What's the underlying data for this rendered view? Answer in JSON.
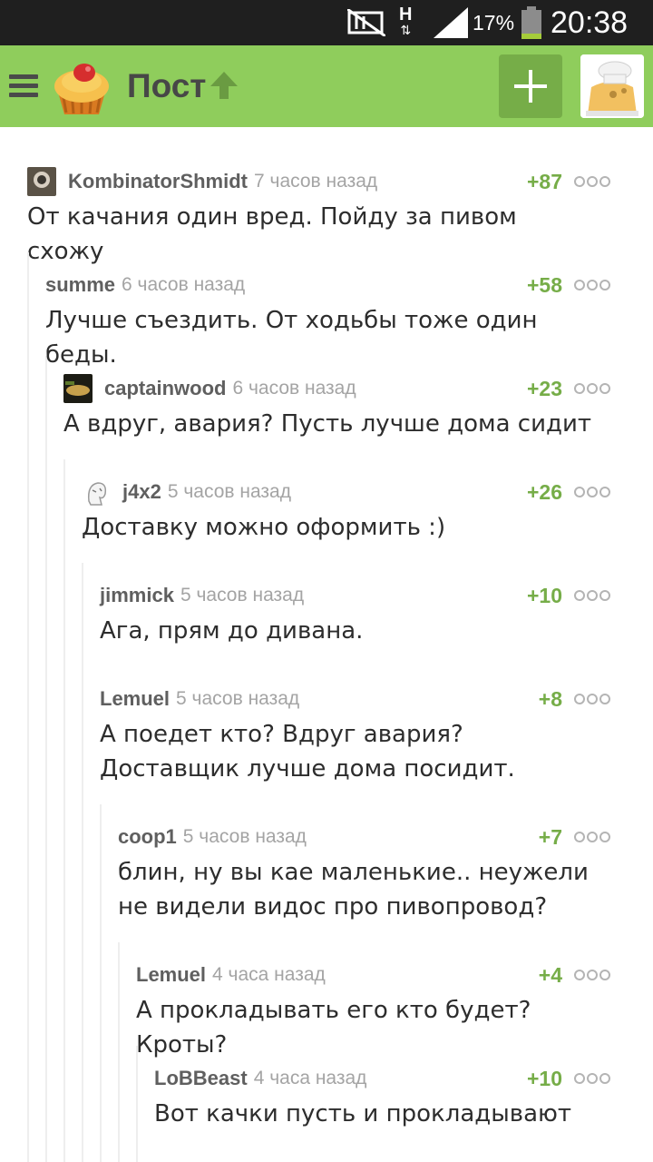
{
  "status_bar": {
    "battery": "17%",
    "time": "20:38",
    "network": "H"
  },
  "header": {
    "title": "Пост"
  },
  "comments": [
    {
      "author": "KombinatorShmidt",
      "time": "7 часов назад",
      "rating": "+87",
      "text": "От качания один вред. Пойду за пивом схожу",
      "avatar": "user-avatar"
    },
    {
      "author": "summe",
      "time": "6 часов назад",
      "rating": "+58",
      "text": "Лучше съездить. От ходьбы тоже один беды.",
      "avatar": ""
    },
    {
      "author": "captainwood",
      "time": "6 часов назад",
      "rating": "+23",
      "text": "А вдруг, авария? Пусть лучше дома сидит",
      "avatar": "user-avatar"
    },
    {
      "author": "j4x2",
      "time": "5 часов назад",
      "rating": "+26",
      "text": "Доставку можно оформить :)",
      "avatar": "user-avatar"
    },
    {
      "author": "jimmick",
      "time": "5 часов назад",
      "rating": "+10",
      "text": "Ага, прям до дивана.",
      "avatar": ""
    },
    {
      "author": "Lemuel",
      "time": "5 часов назад",
      "rating": "+8",
      "text": "А поедет кто? Вдруг авария? Доставщик лучше дома посидит.",
      "avatar": ""
    },
    {
      "author": "coop1",
      "time": "5 часов назад",
      "rating": "+7",
      "text": "блин, ну вы кае маленькие.. неужели не видели видос про пивопровод?",
      "avatar": ""
    },
    {
      "author": "Lemuel",
      "time": "4 часа назад",
      "rating": "+4",
      "text": "А прокладывать его кто будет? Кроты?",
      "avatar": ""
    },
    {
      "author": "LoBBeast",
      "time": "4 часа назад",
      "rating": "+10",
      "text": "Вот качки пусть и прокладывают",
      "avatar": ""
    }
  ]
}
